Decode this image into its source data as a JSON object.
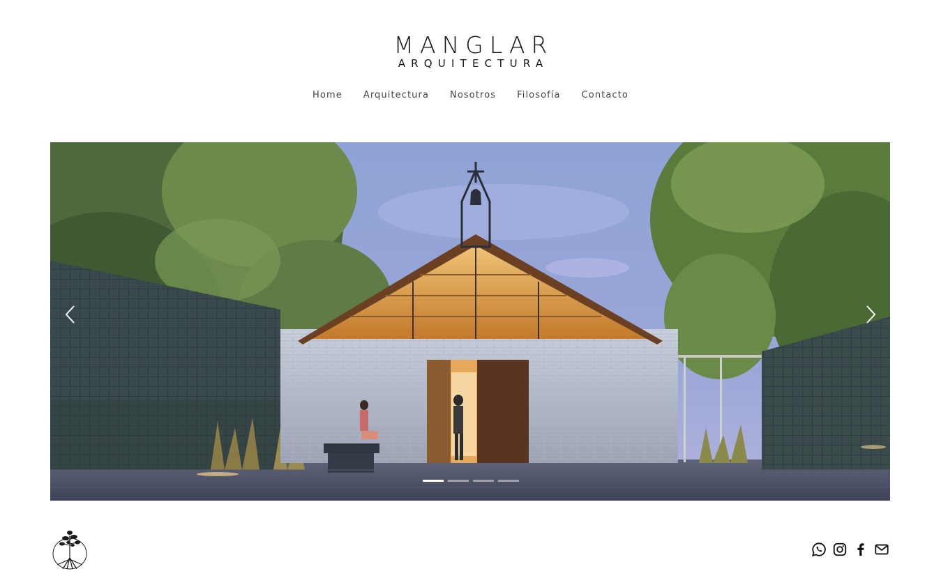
{
  "site": {
    "logo_main": "MANGLAR",
    "logo_sub": "ARQUITECTURA"
  },
  "nav": [
    {
      "label": "Home"
    },
    {
      "label": "Arquitectura"
    },
    {
      "label": "Nosotros"
    },
    {
      "label": "Filosofía"
    },
    {
      "label": "Contacto"
    }
  ],
  "slider": {
    "slide_count": 4,
    "active_slide": 1,
    "prev_icon": "chevron-left-icon",
    "next_icon": "chevron-right-icon"
  },
  "footer": {
    "tree_logo_icon": "mangrove-tree-icon",
    "social": [
      "whatsapp-icon",
      "instagram-icon",
      "facebook-icon",
      "email-icon"
    ]
  },
  "colors": {
    "text": "#161616",
    "nav": "#444444",
    "background": "#ffffff"
  }
}
